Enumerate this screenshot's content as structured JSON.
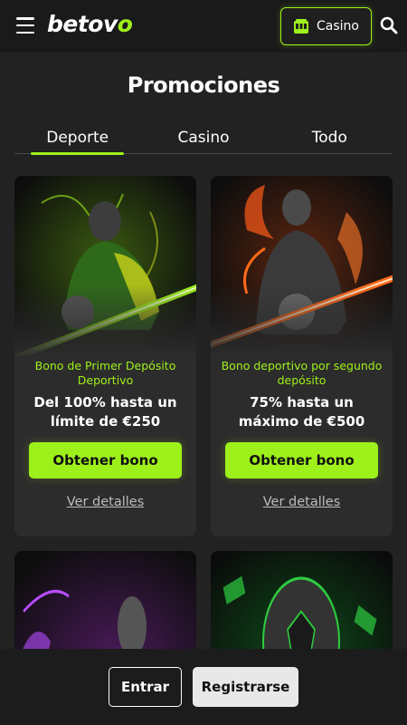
{
  "header": {
    "logo_main": "betov",
    "logo_accent": "o",
    "casino_label": "Casino",
    "menu_icon": "hamburger-menu-icon",
    "search_icon": "search-icon",
    "casino_icon": "slot-machine-icon"
  },
  "page": {
    "title": "Promociones"
  },
  "tabs": [
    {
      "label": "Deporte",
      "active": true
    },
    {
      "label": "Casino",
      "active": false
    },
    {
      "label": "Todo",
      "active": false
    }
  ],
  "cards": [
    {
      "subtitle": "Bono de Primer Depósito Deportivo",
      "headline": "Del 100% hasta un límite de €250",
      "button": "Obtener bono",
      "link": "Ver detalles",
      "accent": "#9ef01a"
    },
    {
      "subtitle": "Bono deportivo por segundo depósito",
      "headline": "75% hasta un máximo de €500",
      "button": "Obtener bono",
      "link": "Ver detalles",
      "accent": "#ff6a1a"
    },
    {
      "accent": "#b84dff"
    },
    {
      "accent": "#2ecc40"
    }
  ],
  "bottom": {
    "login": "Entrar",
    "register": "Registrarse"
  },
  "colors": {
    "brand_green": "#9ef01a",
    "background": "#222222"
  }
}
